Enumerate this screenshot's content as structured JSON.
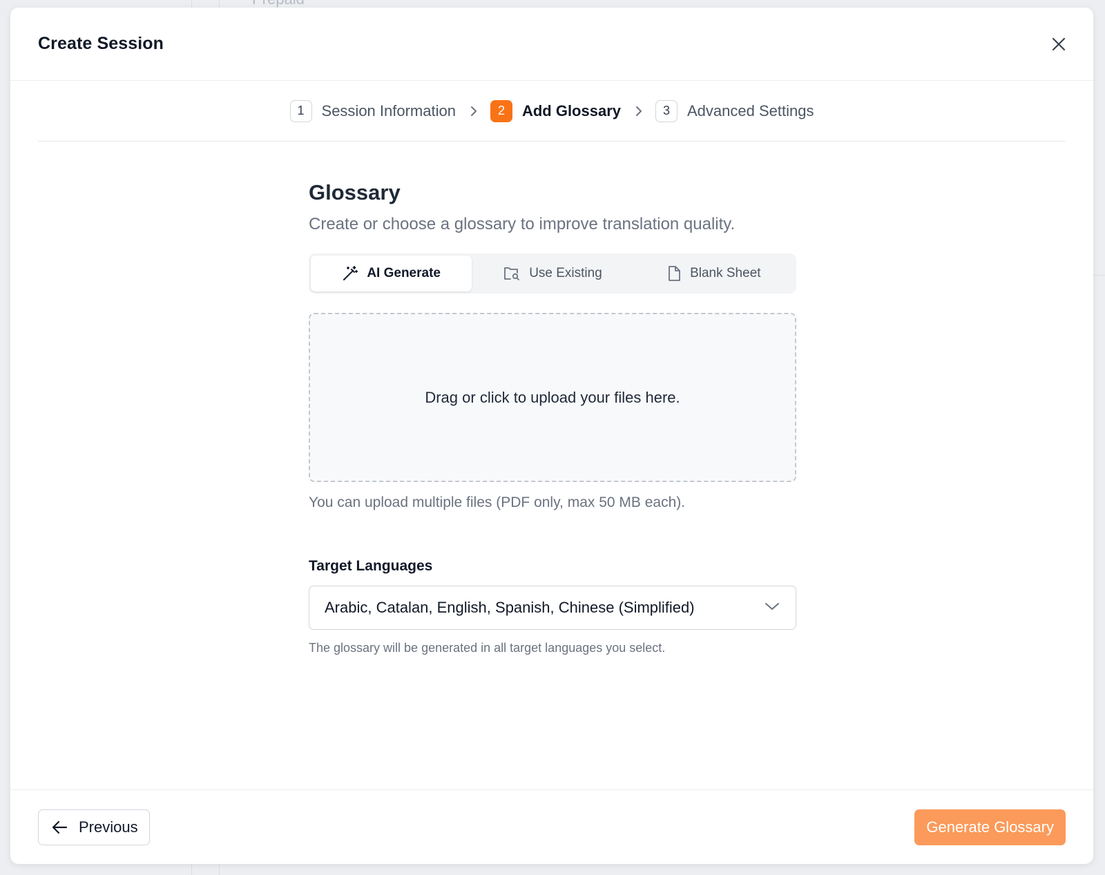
{
  "background": {
    "partial_text": "Prepaid"
  },
  "modal": {
    "title": "Create Session",
    "close_icon": "close-icon"
  },
  "stepper": {
    "steps": [
      {
        "number": "1",
        "label": "Session Information",
        "active": false
      },
      {
        "number": "2",
        "label": "Add Glossary",
        "active": true
      },
      {
        "number": "3",
        "label": "Advanced Settings",
        "active": false
      }
    ]
  },
  "glossary": {
    "title": "Glossary",
    "subtitle": "Create or choose a glossary to improve translation quality.",
    "tabs": [
      {
        "label": "AI Generate",
        "icon": "magic-wand-icon",
        "active": true
      },
      {
        "label": "Use Existing",
        "icon": "folder-search-icon",
        "active": false
      },
      {
        "label": "Blank Sheet",
        "icon": "file-icon",
        "active": false
      }
    ],
    "dropzone_text": "Drag or click to upload your files here.",
    "upload_hint": "You can upload multiple files (PDF only, max 50 MB each)."
  },
  "target_languages": {
    "label": "Target Languages",
    "selected_value": "Arabic, Catalan, English, Spanish, Chinese (Simplified)",
    "help_text": "The glossary will be generated in all target languages you select."
  },
  "footer": {
    "previous_label": "Previous",
    "generate_label": "Generate Glossary"
  },
  "colors": {
    "accent": "#f97316",
    "primary_button": "#fb9a5a"
  }
}
